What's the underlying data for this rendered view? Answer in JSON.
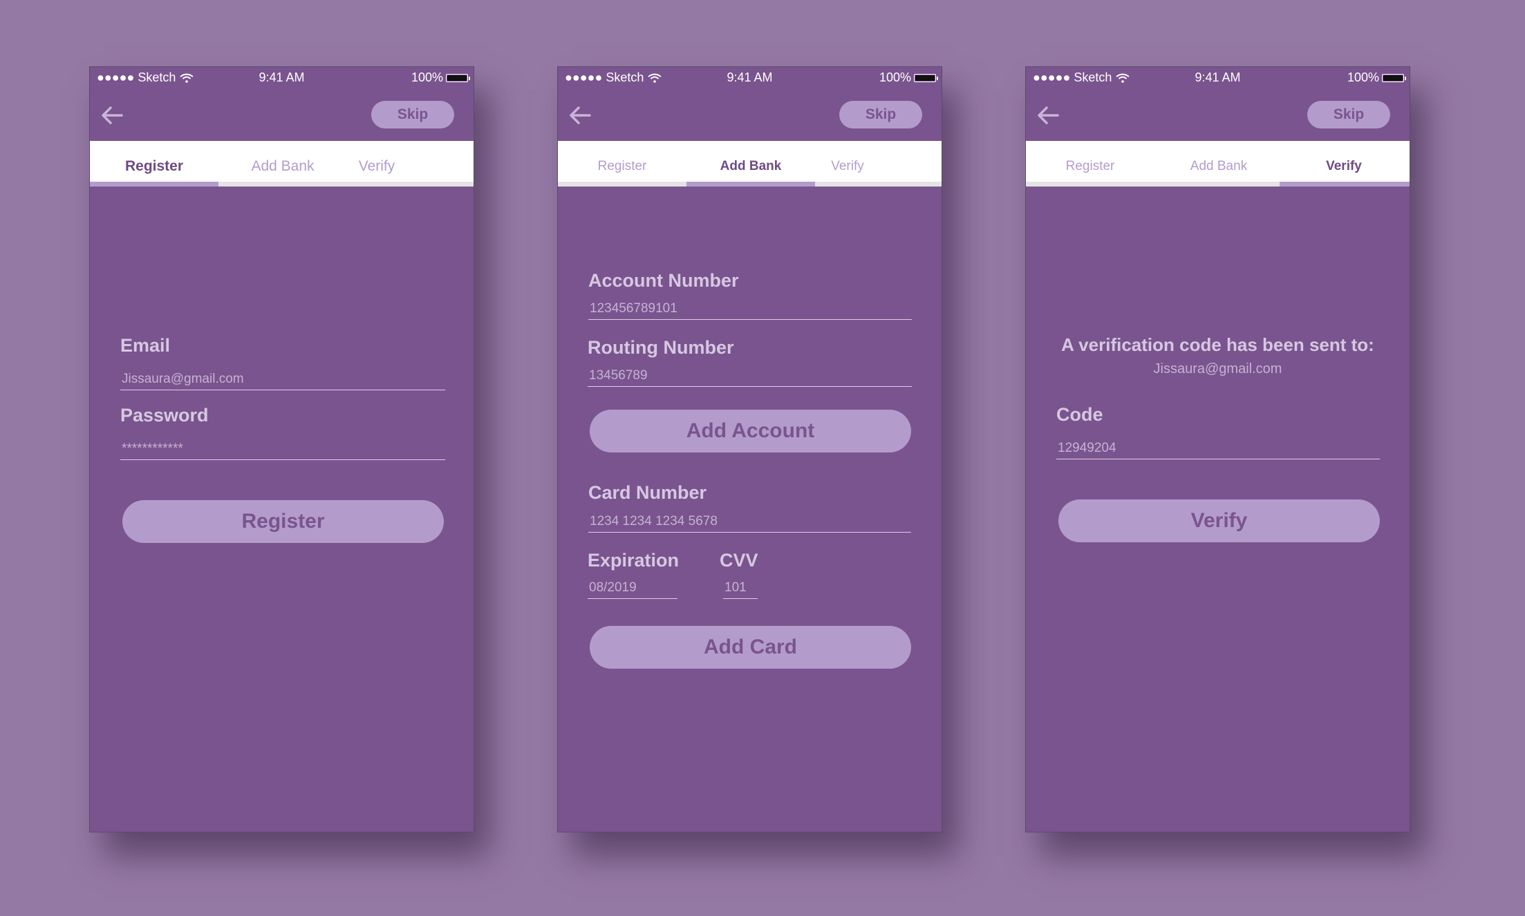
{
  "screens": [
    {
      "status": {
        "carrier": "●●●●● Sketch",
        "time": "9:41 AM",
        "battery": "100%"
      },
      "skip_label": "Skip",
      "tabs": [
        {
          "label": "Register"
        },
        {
          "label": "Add Bank"
        },
        {
          "label": "Verify"
        }
      ],
      "active_tab": 0,
      "email_label": "Email",
      "email_value": "Jissaura@gmail.com",
      "password_label": "Password",
      "password_value": "************",
      "register_button": "Register"
    },
    {
      "status": {
        "carrier": "●●●●● Sketch",
        "time": "9:41 AM",
        "battery": "100%"
      },
      "skip_label": "Skip",
      "tabs": [
        {
          "label": "Register"
        },
        {
          "label": "Add Bank"
        },
        {
          "label": "Verify"
        }
      ],
      "active_tab": 1,
      "account_number_label": "Account Number",
      "account_number_value": "123456789101",
      "routing_number_label": "Routing Number",
      "routing_number_value": "13456789",
      "add_account_button": "Add Account",
      "card_number_label": "Card Number",
      "card_number_value": "1234 1234 1234 5678",
      "expiration_label": "Expiration",
      "expiration_value": "08/2019",
      "cvv_label": "CVV",
      "cvv_value": "101",
      "add_card_button": "Add Card"
    },
    {
      "status": {
        "carrier": "●●●●● Sketch",
        "time": "9:41 AM",
        "battery": "100%"
      },
      "skip_label": "Skip",
      "tabs": [
        {
          "label": "Register"
        },
        {
          "label": "Add Bank"
        },
        {
          "label": "Verify"
        }
      ],
      "active_tab": 2,
      "sent_message": "A verification code has been sent to:",
      "sent_email": "Jissaura@gmail.com",
      "code_label": "Code",
      "code_value": "12949204",
      "verify_button": "Verify"
    }
  ],
  "colors": {
    "page_background": "#9479a4",
    "screen_background": "#7a548e",
    "accent": "#b39ccc",
    "active_tab_text": "#6e4a84"
  },
  "icons": [
    "back-arrow-icon",
    "wifi-icon",
    "battery-icon"
  ]
}
